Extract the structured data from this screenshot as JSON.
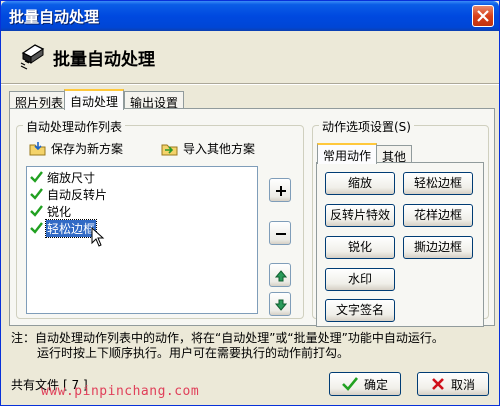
{
  "window": {
    "title": "批量自动处理"
  },
  "header": {
    "title": "批量自动处理",
    "icon": "batch-process-icon"
  },
  "main_tabs": [
    {
      "label": "照片列表"
    },
    {
      "label": "自动处理"
    },
    {
      "label": "输出设置"
    }
  ],
  "action_list_group": {
    "label": "自动处理动作列表",
    "save_label": "保存为新方案",
    "import_label": "导入其他方案",
    "items": [
      {
        "label": "缩放尺寸",
        "checked": true
      },
      {
        "label": "自动反转片",
        "checked": true
      },
      {
        "label": "锐化",
        "checked": true
      },
      {
        "label": "轻松边框",
        "checked": true
      }
    ],
    "side_buttons": [
      "add-icon",
      "remove-icon",
      "move-up-icon",
      "move-down-icon"
    ]
  },
  "options_group": {
    "label": "动作选项设置(S)",
    "tabs": [
      {
        "label": "常用动作"
      },
      {
        "label": "其他"
      }
    ],
    "buttons": [
      {
        "label": "缩放"
      },
      {
        "label": "轻松边框"
      },
      {
        "label": "反转片特效"
      },
      {
        "label": "花样边框"
      },
      {
        "label": "锐化"
      },
      {
        "label": "撕边边框"
      },
      {
        "label": "水印"
      },
      {
        "label": "文字签名"
      }
    ]
  },
  "note": {
    "line1": "注：自动处理动作列表中的动作，将在“自动处理”或“批量处理”功能中自动运行。",
    "line2": "运行时按上下顺序执行。用户可在需要执行的动作前打勾。"
  },
  "status": {
    "label": "共有文件",
    "count": "[ 7 ]"
  },
  "watermark": "www.pinpinchang.com",
  "footer": {
    "ok_label": "确定",
    "cancel_label": "取消"
  },
  "colors": {
    "titlebar": "#0049e0",
    "selection": "#316ac5",
    "check": "#21a121",
    "cancel_x": "#d0101a"
  }
}
